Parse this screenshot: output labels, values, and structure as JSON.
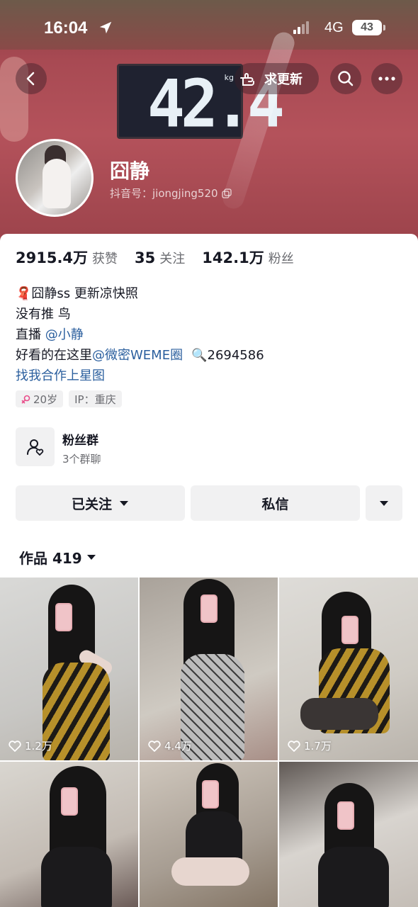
{
  "status_bar": {
    "time": "16:04",
    "network": "4G",
    "battery": "43"
  },
  "nav": {
    "update_label": "求更新"
  },
  "banner": {
    "scale_reading": "42.4",
    "scale_unit": "kg"
  },
  "profile": {
    "name": "囧静",
    "douyin_id": "抖音号：jiongjing520"
  },
  "stats": [
    {
      "value": "2915.4万",
      "label": "获赞"
    },
    {
      "value": "35",
      "label": "关注"
    },
    {
      "value": "142.1万",
      "label": "粉丝"
    }
  ],
  "bio": {
    "line1_emoji": "🧣",
    "line1": "囧静ss 更新凉快照",
    "line2": "没有推  鸟",
    "line3_prefix": "直播 ",
    "line3_link": "@小静",
    "line4_prefix": "好看的在这里",
    "line4_link": "@微密WEME圈",
    "line4_search": "🔍",
    "line4_number": "2694586",
    "line5_link": "找我合作上星图"
  },
  "tags": {
    "age": "20岁",
    "ip": "IP：重庆"
  },
  "fan_group": {
    "title": "粉丝群",
    "subtitle": "3个群聊"
  },
  "actions": {
    "follow": "已关注",
    "message": "私信"
  },
  "works": {
    "label": "作品 419"
  },
  "grid": [
    {
      "likes": "1.2万"
    },
    {
      "likes": "4.4万"
    },
    {
      "likes": "1.7万"
    },
    {
      "likes": ""
    },
    {
      "likes": ""
    },
    {
      "likes": ""
    }
  ],
  "colors": {
    "link": "#2b5f9e",
    "text": "#161823",
    "muted": "#6a6b70",
    "button_bg": "#f1f1f2"
  }
}
